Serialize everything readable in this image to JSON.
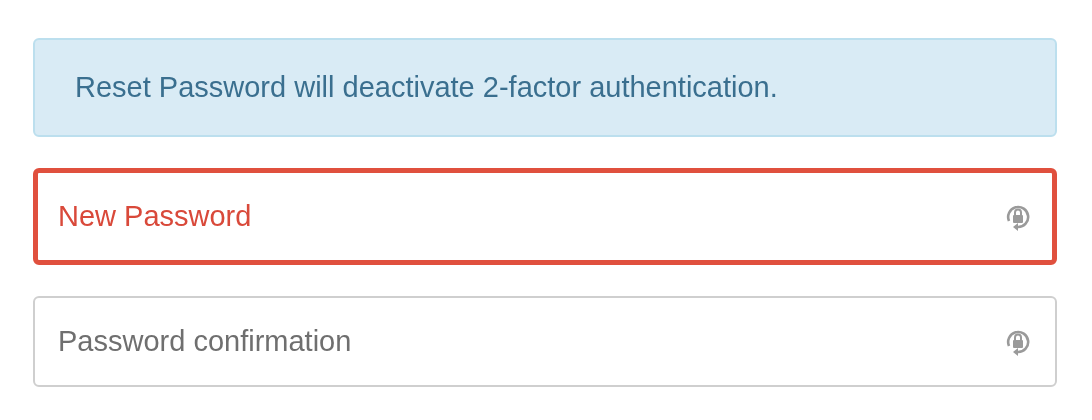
{
  "alert": {
    "text": "Reset Password will deactivate 2-factor authentication."
  },
  "fields": [
    {
      "placeholder": "New Password",
      "invalid": true
    },
    {
      "placeholder": "Password confirmation",
      "invalid": false
    }
  ]
}
